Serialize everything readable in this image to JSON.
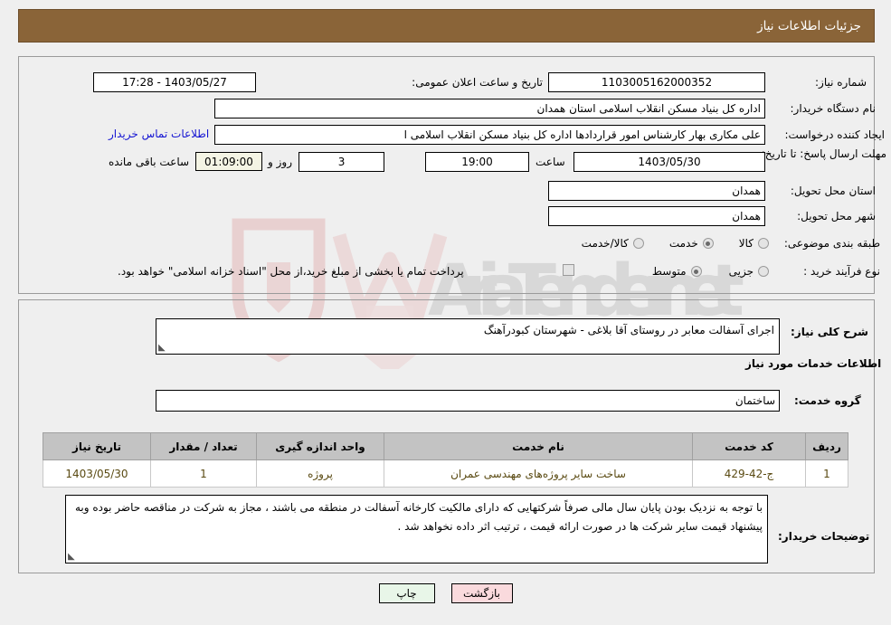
{
  "header": {
    "title": "جزئیات اطلاعات نیاز"
  },
  "form": {
    "need_number_label": "شماره نیاز:",
    "need_number_value": "1103005162000352",
    "announce_datetime_label": "تاریخ و ساعت اعلان عمومی:",
    "announce_datetime_value": "1403/05/27 - 17:28",
    "buyer_org_label": "نام دستگاه خریدار:",
    "buyer_org_value": "اداره کل بنیاد مسکن انقلاب اسلامی استان همدان",
    "requester_label": "ایجاد کننده درخواست:",
    "requester_value": "علی مکاری بهار کارشناس امور قراردادها اداره کل بنیاد مسکن انقلاب اسلامی ا",
    "buyer_contact_link": "اطلاعات تماس خریدار",
    "deadline_label": "مهلت ارسال پاسخ: تا تاریخ:",
    "deadline_date": "1403/05/30",
    "deadline_hour_label": "ساعت",
    "deadline_hour_value": "19:00",
    "days_remaining": "3",
    "days_label": "روز و",
    "countdown_value": "01:09:00",
    "countdown_label": "ساعت باقی مانده",
    "province_label": "استان محل تحویل:",
    "province_value": "همدان",
    "city_label": "شهر محل تحویل:",
    "city_value": "همدان",
    "category_label": "طبقه بندی موضوعی:",
    "category_options": [
      {
        "label": "کالا",
        "checked": false
      },
      {
        "label": "خدمت",
        "checked": true
      },
      {
        "label": "کالا/خدمت",
        "checked": false
      }
    ],
    "process_label": "نوع فرآیند خرید :",
    "process_options": [
      {
        "label": "جزیی",
        "checked": false
      },
      {
        "label": "متوسط",
        "checked": true
      }
    ],
    "treasury_note": "پرداخت تمام یا بخشی از مبلغ خرید،از محل \"اسناد خزانه اسلامی\" خواهد بود."
  },
  "details": {
    "general_desc_label": "شرح کلی نیاز:",
    "general_desc_value": "اجرای آسفالت معابر در روستای آقا بلاغی - شهرستان کبودرآهنگ",
    "services_info_title": "اطلاعات خدمات مورد نیاز",
    "service_group_label": "گروه خدمت:",
    "service_group_value": "ساختمان"
  },
  "table": {
    "columns": [
      "ردیف",
      "کد خدمت",
      "نام خدمت",
      "واحد اندازه گیری",
      "تعداد / مقدار",
      "تاریخ نیاز"
    ],
    "rows": [
      {
        "index": "1",
        "code": "ج-42-429",
        "name": "ساخت سایر پروژه‌های مهندسی عمران",
        "unit": "پروژه",
        "quantity": "1",
        "need_date": "1403/05/30"
      }
    ]
  },
  "notes": {
    "buyer_notes_label": "توضیحات خریدار:",
    "buyer_notes_value": "با توجه به نزدیک بودن پایان سال مالی صرفاً شرکتهایی که دارای مالکیت کارخانه آسفالت در منطقه می باشند ، مجاز به شرکت در مناقصه حاضر بوده وبه پیشنهاد قیمت سایر شرکت ها در صورت ارائه قیمت ، ترتیب اثر داده نخواهد شد ."
  },
  "buttons": {
    "print_label": "چاپ",
    "back_label": "بازگشت"
  },
  "watermark": {
    "text": "AriaTender.net"
  },
  "colors": {
    "header_bar": "#8a6438",
    "page_background": "#efefef",
    "link": "#1414d2",
    "table_header": "#c3c3c3",
    "print_button": "#e8f6e8",
    "back_button": "#fadadd",
    "highlight_field": "#f4f4e4"
  }
}
